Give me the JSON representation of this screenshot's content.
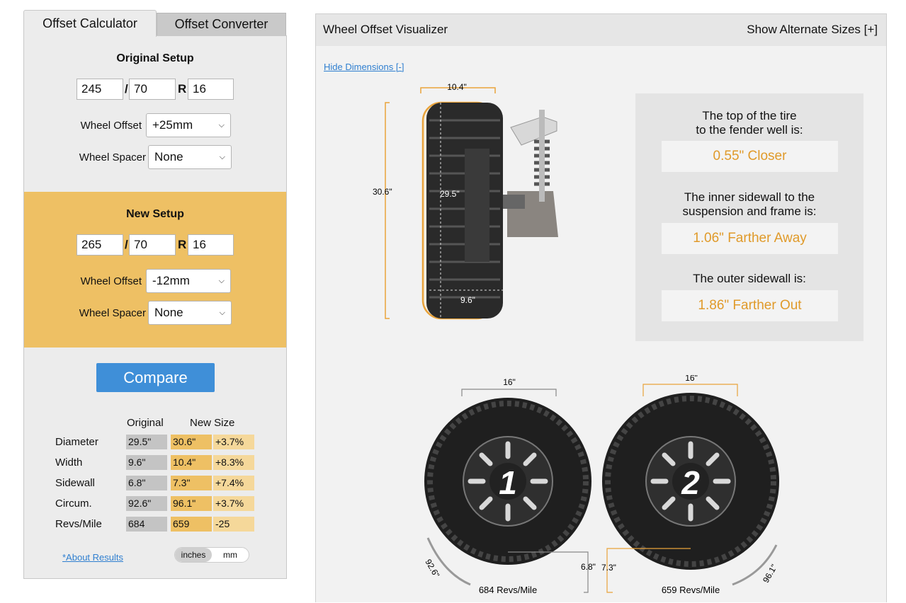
{
  "tabs": {
    "calculator": "Offset Calculator",
    "converter": "Offset Converter"
  },
  "original": {
    "title": "Original Setup",
    "width": "245",
    "sep": "/",
    "aspect": "70",
    "r": "R",
    "rim": "16",
    "offset_label": "Wheel Offset",
    "offset_value": "+25mm",
    "spacer_label": "Wheel Spacer",
    "spacer_value": "None"
  },
  "new_setup": {
    "title": "New Setup",
    "width": "265",
    "sep": "/",
    "aspect": "70",
    "r": "R",
    "rim": "16",
    "offset_label": "Wheel Offset",
    "offset_value": "-12mm",
    "spacer_label": "Wheel Spacer",
    "spacer_value": "None"
  },
  "compare_label": "Compare",
  "results": {
    "col_original": "Original",
    "col_new": "New Size",
    "rows": [
      {
        "label": "Diameter",
        "orig": "29.5\"",
        "new": "30.6\"",
        "diff": "+3.7%"
      },
      {
        "label": "Width",
        "orig": "9.6\"",
        "new": "10.4\"",
        "diff": "+8.3%"
      },
      {
        "label": "Sidewall",
        "orig": "6.8\"",
        "new": "7.3\"",
        "diff": "+7.4%"
      },
      {
        "label": "Circum.",
        "orig": "92.6\"",
        "new": "96.1\"",
        "diff": "+3.7%"
      },
      {
        "label": "Revs/Mile",
        "orig": "684",
        "new": "659",
        "diff": "-25"
      }
    ]
  },
  "about_link": "*About Results",
  "units": {
    "inches": "inches",
    "mm": "mm",
    "selected": "inches"
  },
  "visualizer": {
    "title": "Wheel Offset Visualizer",
    "alt_sizes": "Show Alternate Sizes [+]",
    "hide_dims": "Hide Dimensions [-]",
    "dims": {
      "new_width": "10.4\"",
      "new_height": "30.6\"",
      "orig_height": "29.5\"",
      "orig_width": "9.6\""
    },
    "info": [
      {
        "q1": "The top of the tire",
        "q2": "to the fender well is:",
        "a": "0.55\" Closer"
      },
      {
        "q1": "The inner sidewall to the",
        "q2": "suspension and frame is:",
        "a": "1.06\" Farther Away"
      },
      {
        "q1": "The outer sidewall is:",
        "q2": "",
        "a": "1.86\" Farther Out"
      }
    ],
    "wheel1": {
      "number": "1",
      "rim": "16\"",
      "sidewall": "6.8\"",
      "circ": "92.6\"",
      "revs": "684 Revs/Mile"
    },
    "wheel2": {
      "number": "2",
      "rim": "16\"",
      "sidewall": "7.3\"",
      "circ": "96.1\"",
      "revs": "659 Revs/Mile"
    }
  },
  "colors": {
    "accent_orange": "#eec064",
    "answer_text": "#e09a2a",
    "compare_blue": "#3f8fd8",
    "link_blue": "#2f7fd0"
  }
}
